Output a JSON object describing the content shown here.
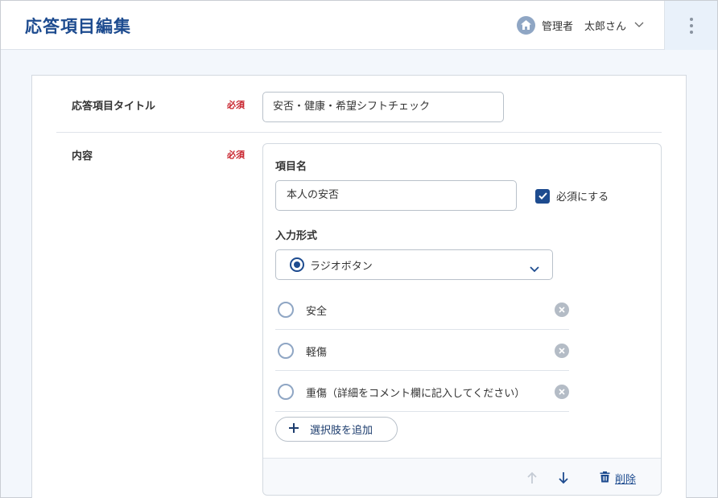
{
  "header": {
    "title": "応答項目編集",
    "role": "管理者",
    "user_name": "太郎さん",
    "icons": [
      "home-icon",
      "chevron-down-icon",
      "kebab-menu-icon"
    ]
  },
  "form": {
    "title_row": {
      "label": "応答項目タイトル",
      "required": "必須",
      "value": "安否・健康・希望シフトチェック"
    },
    "content_row": {
      "label": "内容",
      "required": "必須",
      "item_name_label": "項目名",
      "item_name_value": "本人の安否",
      "required_checkbox_label": "必須にする",
      "required_checked": true,
      "input_type_label": "入力形式",
      "input_type_value": "ラジオボタン",
      "options": [
        {
          "label": "安全"
        },
        {
          "label": "軽傷"
        },
        {
          "label": "重傷（詳細をコメント欄に記入してください）"
        }
      ],
      "add_option_label": "選択肢を追加",
      "delete_label": "削除"
    }
  },
  "colors": {
    "primary": "#1d4b8f",
    "required": "#c8212b",
    "background": "#f3f7fc"
  }
}
